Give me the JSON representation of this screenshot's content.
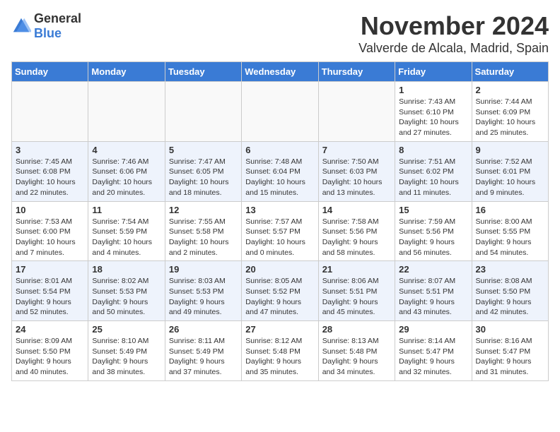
{
  "header": {
    "logo_general": "General",
    "logo_blue": "Blue",
    "month_year": "November 2024",
    "location": "Valverde de Alcala, Madrid, Spain"
  },
  "weekdays": [
    "Sunday",
    "Monday",
    "Tuesday",
    "Wednesday",
    "Thursday",
    "Friday",
    "Saturday"
  ],
  "weeks": [
    [
      {
        "day": "",
        "info": ""
      },
      {
        "day": "",
        "info": ""
      },
      {
        "day": "",
        "info": ""
      },
      {
        "day": "",
        "info": ""
      },
      {
        "day": "",
        "info": ""
      },
      {
        "day": "1",
        "info": "Sunrise: 7:43 AM\nSunset: 6:10 PM\nDaylight: 10 hours and 27 minutes."
      },
      {
        "day": "2",
        "info": "Sunrise: 7:44 AM\nSunset: 6:09 PM\nDaylight: 10 hours and 25 minutes."
      }
    ],
    [
      {
        "day": "3",
        "info": "Sunrise: 7:45 AM\nSunset: 6:08 PM\nDaylight: 10 hours and 22 minutes."
      },
      {
        "day": "4",
        "info": "Sunrise: 7:46 AM\nSunset: 6:06 PM\nDaylight: 10 hours and 20 minutes."
      },
      {
        "day": "5",
        "info": "Sunrise: 7:47 AM\nSunset: 6:05 PM\nDaylight: 10 hours and 18 minutes."
      },
      {
        "day": "6",
        "info": "Sunrise: 7:48 AM\nSunset: 6:04 PM\nDaylight: 10 hours and 15 minutes."
      },
      {
        "day": "7",
        "info": "Sunrise: 7:50 AM\nSunset: 6:03 PM\nDaylight: 10 hours and 13 minutes."
      },
      {
        "day": "8",
        "info": "Sunrise: 7:51 AM\nSunset: 6:02 PM\nDaylight: 10 hours and 11 minutes."
      },
      {
        "day": "9",
        "info": "Sunrise: 7:52 AM\nSunset: 6:01 PM\nDaylight: 10 hours and 9 minutes."
      }
    ],
    [
      {
        "day": "10",
        "info": "Sunrise: 7:53 AM\nSunset: 6:00 PM\nDaylight: 10 hours and 7 minutes."
      },
      {
        "day": "11",
        "info": "Sunrise: 7:54 AM\nSunset: 5:59 PM\nDaylight: 10 hours and 4 minutes."
      },
      {
        "day": "12",
        "info": "Sunrise: 7:55 AM\nSunset: 5:58 PM\nDaylight: 10 hours and 2 minutes."
      },
      {
        "day": "13",
        "info": "Sunrise: 7:57 AM\nSunset: 5:57 PM\nDaylight: 10 hours and 0 minutes."
      },
      {
        "day": "14",
        "info": "Sunrise: 7:58 AM\nSunset: 5:56 PM\nDaylight: 9 hours and 58 minutes."
      },
      {
        "day": "15",
        "info": "Sunrise: 7:59 AM\nSunset: 5:56 PM\nDaylight: 9 hours and 56 minutes."
      },
      {
        "day": "16",
        "info": "Sunrise: 8:00 AM\nSunset: 5:55 PM\nDaylight: 9 hours and 54 minutes."
      }
    ],
    [
      {
        "day": "17",
        "info": "Sunrise: 8:01 AM\nSunset: 5:54 PM\nDaylight: 9 hours and 52 minutes."
      },
      {
        "day": "18",
        "info": "Sunrise: 8:02 AM\nSunset: 5:53 PM\nDaylight: 9 hours and 50 minutes."
      },
      {
        "day": "19",
        "info": "Sunrise: 8:03 AM\nSunset: 5:53 PM\nDaylight: 9 hours and 49 minutes."
      },
      {
        "day": "20",
        "info": "Sunrise: 8:05 AM\nSunset: 5:52 PM\nDaylight: 9 hours and 47 minutes."
      },
      {
        "day": "21",
        "info": "Sunrise: 8:06 AM\nSunset: 5:51 PM\nDaylight: 9 hours and 45 minutes."
      },
      {
        "day": "22",
        "info": "Sunrise: 8:07 AM\nSunset: 5:51 PM\nDaylight: 9 hours and 43 minutes."
      },
      {
        "day": "23",
        "info": "Sunrise: 8:08 AM\nSunset: 5:50 PM\nDaylight: 9 hours and 42 minutes."
      }
    ],
    [
      {
        "day": "24",
        "info": "Sunrise: 8:09 AM\nSunset: 5:50 PM\nDaylight: 9 hours and 40 minutes."
      },
      {
        "day": "25",
        "info": "Sunrise: 8:10 AM\nSunset: 5:49 PM\nDaylight: 9 hours and 38 minutes."
      },
      {
        "day": "26",
        "info": "Sunrise: 8:11 AM\nSunset: 5:49 PM\nDaylight: 9 hours and 37 minutes."
      },
      {
        "day": "27",
        "info": "Sunrise: 8:12 AM\nSunset: 5:48 PM\nDaylight: 9 hours and 35 minutes."
      },
      {
        "day": "28",
        "info": "Sunrise: 8:13 AM\nSunset: 5:48 PM\nDaylight: 9 hours and 34 minutes."
      },
      {
        "day": "29",
        "info": "Sunrise: 8:14 AM\nSunset: 5:47 PM\nDaylight: 9 hours and 32 minutes."
      },
      {
        "day": "30",
        "info": "Sunrise: 8:16 AM\nSunset: 5:47 PM\nDaylight: 9 hours and 31 minutes."
      }
    ]
  ]
}
